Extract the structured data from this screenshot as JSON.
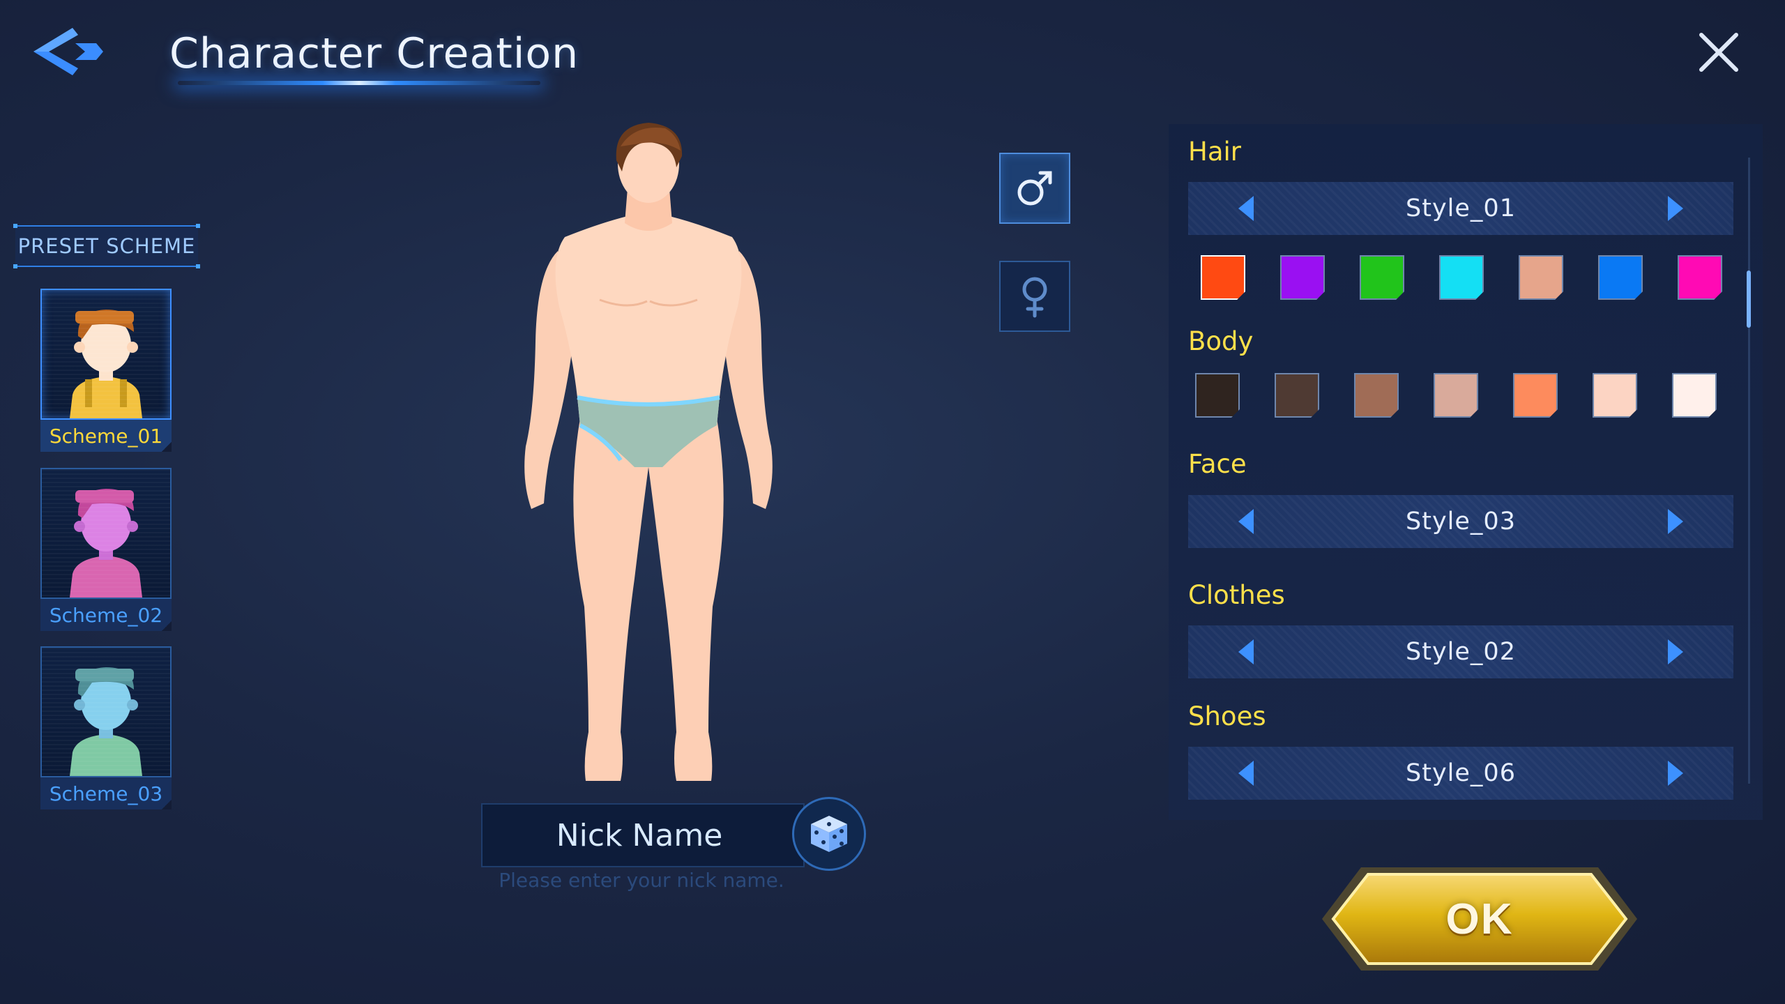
{
  "header": {
    "title": "Character Creation"
  },
  "preset": {
    "label": "PRESET SCHEME",
    "schemes": [
      {
        "name": "Scheme_01",
        "tint": "#f3b35d",
        "active": true
      },
      {
        "name": "Scheme_02",
        "tint": "#e072d8",
        "active": false
      },
      {
        "name": "Scheme_03",
        "tint": "#7ec6e8",
        "active": false
      }
    ]
  },
  "gender": {
    "selected": "male",
    "options": [
      "male",
      "female"
    ]
  },
  "nickname": {
    "label": "Nick Name",
    "hint": "Please enter your nick name."
  },
  "customize": {
    "hair": {
      "label": "Hair",
      "style": "Style_01",
      "colors": [
        "#ff4a12",
        "#9a10f2",
        "#21c41b",
        "#14dff4",
        "#e6a58b",
        "#0a79f4",
        "#ff0ab4"
      ],
      "selected_color": 0
    },
    "body": {
      "label": "Body",
      "colors": [
        "#2f241f",
        "#4f3a33",
        "#a06c56",
        "#d9aa9b",
        "#fd8b5d",
        "#fcd4c3",
        "#fff0eb"
      ]
    },
    "face": {
      "label": "Face",
      "style": "Style_03"
    },
    "clothes": {
      "label": "Clothes",
      "style": "Style_02"
    },
    "shoes": {
      "label": "Shoes",
      "style": "Style_06"
    }
  },
  "actions": {
    "ok_label": "OK"
  },
  "colors": {
    "accent": "#2f8cff",
    "label_yellow": "#ffe04a",
    "ok_gold": "#e0b614"
  }
}
